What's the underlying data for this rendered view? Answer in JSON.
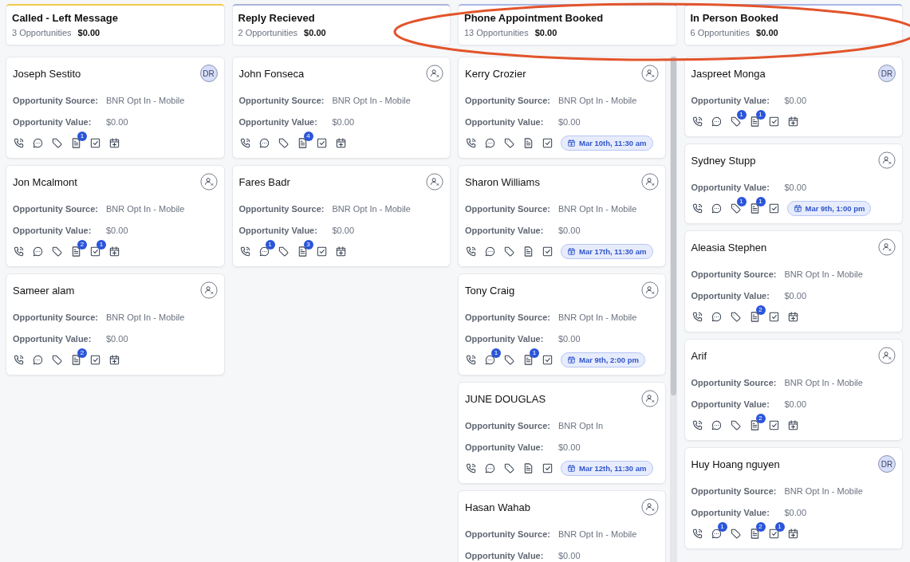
{
  "stages": [
    {
      "title": "Called - Left Message",
      "count": "3 Opportunities",
      "total": "$0.00",
      "color": "#f2c94c",
      "scrollable": false,
      "cards": [
        {
          "name": "Joseph Sestito",
          "assignee": "DR",
          "fields": [
            {
              "label": "Opportunity Source:",
              "value": "BNR Opt In - Mobile"
            },
            {
              "label": "Opportunity Value:",
              "value": "$0.00"
            }
          ],
          "actions": [
            {
              "kind": "call"
            },
            {
              "kind": "message"
            },
            {
              "kind": "tag"
            },
            {
              "kind": "note",
              "badge": "1"
            },
            {
              "kind": "task"
            },
            {
              "kind": "calendar"
            }
          ]
        },
        {
          "name": "Jon Mcalmont",
          "fields": [
            {
              "label": "Opportunity Source:",
              "value": "BNR Opt In - Mobile"
            },
            {
              "label": "Opportunity Value:",
              "value": "$0.00"
            }
          ],
          "actions": [
            {
              "kind": "call"
            },
            {
              "kind": "message"
            },
            {
              "kind": "tag"
            },
            {
              "kind": "note",
              "badge": "2"
            },
            {
              "kind": "task",
              "badge": "1"
            },
            {
              "kind": "calendar"
            }
          ]
        },
        {
          "name": "Sameer alam",
          "fields": [
            {
              "label": "Opportunity Source:",
              "value": "BNR Opt In - Mobile"
            },
            {
              "label": "Opportunity Value:",
              "value": "$0.00"
            }
          ],
          "actions": [
            {
              "kind": "call"
            },
            {
              "kind": "message"
            },
            {
              "kind": "tag"
            },
            {
              "kind": "note",
              "badge": "2"
            },
            {
              "kind": "task"
            },
            {
              "kind": "calendar"
            }
          ]
        }
      ]
    },
    {
      "title": "Reply Recieved",
      "count": "2 Opportunities",
      "total": "$0.00",
      "color": "#a9b3d6",
      "scrollable": false,
      "cards": [
        {
          "name": "John Fonseca",
          "fields": [
            {
              "label": "Opportunity Source:",
              "value": "BNR Opt In - Mobile"
            },
            {
              "label": "Opportunity Value:",
              "value": "$0.00"
            }
          ],
          "actions": [
            {
              "kind": "call"
            },
            {
              "kind": "message"
            },
            {
              "kind": "tag"
            },
            {
              "kind": "note",
              "badge": "4"
            },
            {
              "kind": "task"
            },
            {
              "kind": "calendar"
            }
          ]
        },
        {
          "name": "Fares Badr",
          "fields": [
            {
              "label": "Opportunity Source:",
              "value": "BNR Opt In - Mobile"
            },
            {
              "label": "Opportunity Value:",
              "value": "$0.00"
            }
          ],
          "actions": [
            {
              "kind": "call"
            },
            {
              "kind": "message",
              "badge": "1"
            },
            {
              "kind": "tag"
            },
            {
              "kind": "note",
              "badge": "3"
            },
            {
              "kind": "task"
            },
            {
              "kind": "calendar"
            }
          ]
        }
      ]
    },
    {
      "title": "Phone Appointment Booked",
      "count": "13 Opportunities",
      "total": "$0.00",
      "color": "#a9b6e6",
      "scrollable": true,
      "cards": [
        {
          "name": "Kerry Crozier",
          "fields": [
            {
              "label": "Opportunity Source:",
              "value": "BNR Opt In - Mobile"
            },
            {
              "label": "Opportunity Value:",
              "value": "$0.00"
            }
          ],
          "actions": [
            {
              "kind": "call"
            },
            {
              "kind": "message"
            },
            {
              "kind": "tag"
            },
            {
              "kind": "note"
            },
            {
              "kind": "task"
            }
          ],
          "appointment": "Mar 10th, 11:30 am"
        },
        {
          "name": "Sharon Williams",
          "fields": [
            {
              "label": "Opportunity Source:",
              "value": "BNR Opt In - Mobile"
            },
            {
              "label": "Opportunity Value:",
              "value": "$0.00"
            }
          ],
          "actions": [
            {
              "kind": "call"
            },
            {
              "kind": "message"
            },
            {
              "kind": "tag"
            },
            {
              "kind": "note"
            },
            {
              "kind": "task"
            }
          ],
          "appointment": "Mar 17th, 11:30 am"
        },
        {
          "name": "Tony Craig",
          "fields": [
            {
              "label": "Opportunity Source:",
              "value": "BNR Opt In - Mobile"
            },
            {
              "label": "Opportunity Value:",
              "value": "$0.00"
            }
          ],
          "actions": [
            {
              "kind": "call"
            },
            {
              "kind": "message",
              "badge": "1"
            },
            {
              "kind": "tag"
            },
            {
              "kind": "note",
              "badge": "1"
            },
            {
              "kind": "task"
            }
          ],
          "appointment": "Mar 9th, 2:00 pm"
        },
        {
          "name": "JUNE DOUGLAS",
          "fields": [
            {
              "label": "Opportunity Source:",
              "value": "BNR Opt In"
            },
            {
              "label": "Opportunity Value:",
              "value": "$0.00"
            }
          ],
          "actions": [
            {
              "kind": "call"
            },
            {
              "kind": "message"
            },
            {
              "kind": "tag"
            },
            {
              "kind": "note"
            },
            {
              "kind": "task"
            }
          ],
          "appointment": "Mar 12th, 11:30 am"
        },
        {
          "name": "Hasan Wahab",
          "fields": [
            {
              "label": "Opportunity Source:",
              "value": "BNR Opt In - Mobile"
            },
            {
              "label": "Opportunity Value:",
              "value": "$0.00"
            }
          ]
        }
      ]
    },
    {
      "title": "In Person Booked",
      "count": "6 Opportunities",
      "total": "$0.00",
      "color": "#a9b6e6",
      "scrollable": false,
      "cards": [
        {
          "name": "Jaspreet Monga",
          "assignee": "DR",
          "fields": [
            {
              "label": "Opportunity Value:",
              "value": "$0.00"
            }
          ],
          "actions": [
            {
              "kind": "call"
            },
            {
              "kind": "message"
            },
            {
              "kind": "tag",
              "badge": "1"
            },
            {
              "kind": "note",
              "badge": "1"
            },
            {
              "kind": "task"
            },
            {
              "kind": "calendar"
            }
          ]
        },
        {
          "name": "Sydney Stupp",
          "fields": [
            {
              "label": "Opportunity Value:",
              "value": "$0.00"
            }
          ],
          "actions": [
            {
              "kind": "call"
            },
            {
              "kind": "message"
            },
            {
              "kind": "tag",
              "badge": "1"
            },
            {
              "kind": "note",
              "badge": "1"
            },
            {
              "kind": "task"
            }
          ],
          "appointment": "Mar 9th, 1:00 pm"
        },
        {
          "name": "Aleasia Stephen",
          "fields": [
            {
              "label": "Opportunity Source:",
              "value": "BNR Opt In - Mobile"
            },
            {
              "label": "Opportunity Value:",
              "value": "$0.00"
            }
          ],
          "actions": [
            {
              "kind": "call"
            },
            {
              "kind": "message"
            },
            {
              "kind": "tag"
            },
            {
              "kind": "note",
              "badge": "2"
            },
            {
              "kind": "task"
            },
            {
              "kind": "calendar"
            }
          ]
        },
        {
          "name": "Arif",
          "fields": [
            {
              "label": "Opportunity Source:",
              "value": "BNR Opt In - Mobile"
            },
            {
              "label": "Opportunity Value:",
              "value": "$0.00"
            }
          ],
          "actions": [
            {
              "kind": "call"
            },
            {
              "kind": "message"
            },
            {
              "kind": "tag"
            },
            {
              "kind": "note",
              "badge": "2"
            },
            {
              "kind": "task"
            },
            {
              "kind": "calendar"
            }
          ]
        },
        {
          "name": "Huy Hoang nguyen",
          "assignee": "DR",
          "fields": [
            {
              "label": "Opportunity Source:",
              "value": "BNR Opt In - Mobile"
            },
            {
              "label": "Opportunity Value:",
              "value": "$0.00"
            }
          ],
          "actions": [
            {
              "kind": "call"
            },
            {
              "kind": "message",
              "badge": "1"
            },
            {
              "kind": "tag"
            },
            {
              "kind": "note",
              "badge": "2"
            },
            {
              "kind": "task",
              "badge": "1"
            },
            {
              "kind": "calendar"
            }
          ]
        }
      ]
    }
  ]
}
